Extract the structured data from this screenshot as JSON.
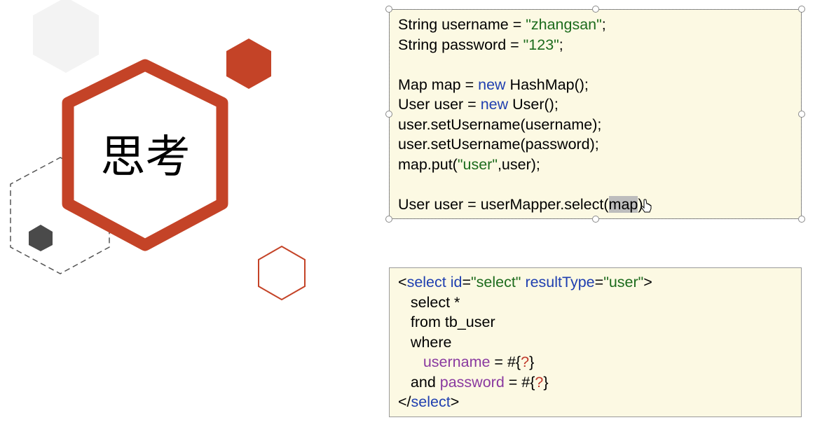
{
  "slide": {
    "title": "思考"
  },
  "code_block_1": {
    "lines": [
      [
        {
          "t": "String username = ",
          "c": ""
        },
        {
          "t": "\"zhangsan\"",
          "c": "str"
        },
        {
          "t": ";",
          "c": ""
        }
      ],
      [
        {
          "t": "String password = ",
          "c": ""
        },
        {
          "t": "\"123\"",
          "c": "str"
        },
        {
          "t": ";",
          "c": ""
        }
      ],
      [],
      [
        {
          "t": "Map map = ",
          "c": ""
        },
        {
          "t": "new",
          "c": "kw"
        },
        {
          "t": " HashMap();",
          "c": ""
        }
      ],
      [
        {
          "t": "User user = ",
          "c": ""
        },
        {
          "t": "new",
          "c": "kw"
        },
        {
          "t": " User();",
          "c": ""
        }
      ],
      [
        {
          "t": "user.setUsername(username);",
          "c": ""
        }
      ],
      [
        {
          "t": "user.setUsername(password);",
          "c": ""
        }
      ],
      [
        {
          "t": "map.put(",
          "c": ""
        },
        {
          "t": "\"user\"",
          "c": "str"
        },
        {
          "t": ",user);",
          "c": ""
        }
      ],
      [],
      [
        {
          "t": "User user = userMapper.select(",
          "c": ""
        },
        {
          "t": "map",
          "c": "hl"
        },
        {
          "t": ");",
          "c": ""
        }
      ]
    ]
  },
  "code_block_2": {
    "lines": [
      [
        {
          "t": "<",
          "c": ""
        },
        {
          "t": "select",
          "c": "attr"
        },
        {
          "t": " ",
          "c": ""
        },
        {
          "t": "id",
          "c": "attr"
        },
        {
          "t": "=",
          "c": ""
        },
        {
          "t": "\"select\"",
          "c": "str"
        },
        {
          "t": " ",
          "c": ""
        },
        {
          "t": "resultType",
          "c": "attr"
        },
        {
          "t": "=",
          "c": ""
        },
        {
          "t": "\"user\"",
          "c": "str"
        },
        {
          "t": ">",
          "c": ""
        }
      ],
      [
        {
          "t": "   select *",
          "c": ""
        }
      ],
      [
        {
          "t": "   from tb_user",
          "c": ""
        }
      ],
      [
        {
          "t": "   where",
          "c": ""
        }
      ],
      [
        {
          "t": "      ",
          "c": ""
        },
        {
          "t": "username",
          "c": "purple"
        },
        {
          "t": " = #{",
          "c": ""
        },
        {
          "t": "?",
          "c": "q"
        },
        {
          "t": "}",
          "c": ""
        }
      ],
      [
        {
          "t": "   and ",
          "c": ""
        },
        {
          "t": "password",
          "c": "purple"
        },
        {
          "t": " = #{",
          "c": ""
        },
        {
          "t": "?",
          "c": "q"
        },
        {
          "t": "}",
          "c": ""
        }
      ],
      [
        {
          "t": "</",
          "c": ""
        },
        {
          "t": "select",
          "c": "attr"
        },
        {
          "t": ">",
          "c": ""
        }
      ]
    ]
  },
  "colors": {
    "accent_red": "#c44327",
    "box_bg": "#fcf9e3",
    "keyword_blue": "#1f3fb0",
    "string_green": "#1c6b1c",
    "param_purple": "#8a3aa0"
  },
  "icons": {
    "cursor": "hand-pointer-icon"
  }
}
